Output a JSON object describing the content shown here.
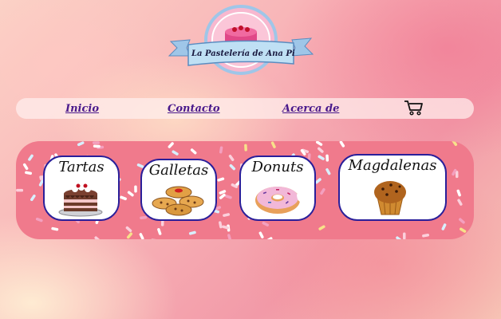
{
  "logo": {
    "text": "La Pastelería de Ana Pi",
    "icon": "cake-icon"
  },
  "nav": {
    "items": [
      {
        "label": "Inicio"
      },
      {
        "label": "Contacto"
      },
      {
        "label": "Acerca de"
      }
    ],
    "cart_icon": "shopping-cart-icon"
  },
  "categories": [
    {
      "label": "Tartas",
      "icon": "cake-icon"
    },
    {
      "label": "Galletas",
      "icon": "cookies-icon"
    },
    {
      "label": "Donuts",
      "icon": "donut-icon"
    },
    {
      "label": "Magdalenas",
      "icon": "muffin-icon"
    }
  ],
  "colors": {
    "accent": "#4a1a8c",
    "card_border": "#2a1f9a",
    "sprinkle_bg": "#f07a8c"
  }
}
